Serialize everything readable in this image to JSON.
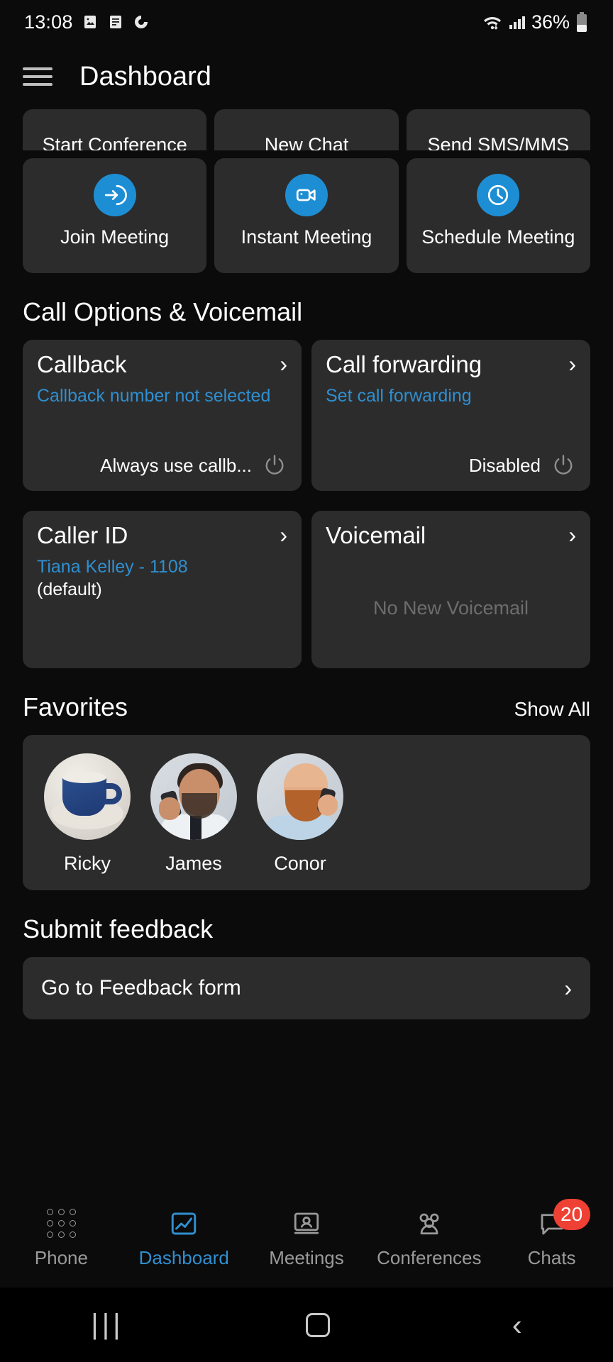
{
  "statusbar": {
    "time": "13:08",
    "battery_percent": "36%",
    "icons": [
      "photo-icon",
      "message-icon",
      "sync-icon",
      "wifi-icon",
      "cellular-signal-icon",
      "battery-icon"
    ]
  },
  "appbar": {
    "title": "Dashboard",
    "menu_icon": "hamburger-menu-icon"
  },
  "quick_actions_row1": [
    {
      "label": "Start Conference"
    },
    {
      "label": "New Chat"
    },
    {
      "label": "Send SMS/MMS"
    }
  ],
  "quick_actions_row2": [
    {
      "label": "Join Meeting",
      "icon": "arrow-into-door-icon"
    },
    {
      "label": "Instant Meeting",
      "icon": "video-camera-icon"
    },
    {
      "label": "Schedule Meeting",
      "icon": "clock-icon"
    }
  ],
  "call_options": {
    "section_title": "Call Options & Voicemail",
    "callback": {
      "title": "Callback",
      "subtitle": "Callback number not selected",
      "footer_label": "Always use callb...",
      "toggle_icon": "power-icon"
    },
    "call_forwarding": {
      "title": "Call forwarding",
      "subtitle": "Set call forwarding",
      "footer_label": "Disabled",
      "toggle_icon": "power-icon"
    },
    "caller_id": {
      "title": "Caller ID",
      "subtitle": "Tiana Kelley - 1108",
      "subtitle2": "(default)"
    },
    "voicemail": {
      "title": "Voicemail",
      "empty_text": "No New Voicemail"
    }
  },
  "favorites": {
    "section_title": "Favorites",
    "show_all": "Show All",
    "items": [
      {
        "name": "Ricky",
        "avatar": "coffee-mug-photo"
      },
      {
        "name": "James",
        "avatar": "man-on-phone-photo"
      },
      {
        "name": "Conor",
        "avatar": "bearded-man-photo"
      }
    ]
  },
  "feedback": {
    "section_title": "Submit feedback",
    "link_label": "Go to Feedback form"
  },
  "bottom_nav": {
    "items": [
      {
        "label": "Phone",
        "icon": "dialpad-icon",
        "active": false,
        "badge": ""
      },
      {
        "label": "Dashboard",
        "icon": "chart-icon",
        "active": true,
        "badge": ""
      },
      {
        "label": "Meetings",
        "icon": "presentation-icon",
        "active": false,
        "badge": ""
      },
      {
        "label": "Conferences",
        "icon": "people-group-icon",
        "active": false,
        "badge": ""
      },
      {
        "label": "Chats",
        "icon": "speech-bubble-icon",
        "active": false,
        "badge": "20"
      }
    ]
  },
  "android_nav": {
    "recent": "|||",
    "home": "home-square-icon",
    "back": "back-chevron-icon"
  },
  "colors": {
    "accent": "#2f8fd0",
    "icon_blue": "#1e8ed4",
    "badge_red": "#ef4034",
    "card": "#2c2c2c",
    "background": "#0b0b0b"
  }
}
